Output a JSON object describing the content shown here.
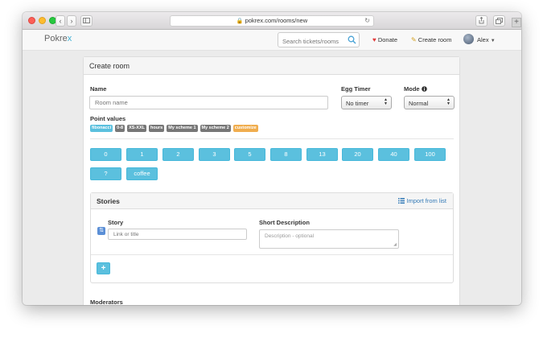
{
  "browser": {
    "url": "pokrex.com/rooms/new",
    "back": "‹",
    "forward": "›"
  },
  "navbar": {
    "brand_main": "Pokre",
    "brand_accent": "x",
    "search_placeholder": "Search tickets/rooms",
    "donate": "Donate",
    "create_room": "Create room",
    "user": "Alex"
  },
  "form": {
    "title": "Create room",
    "name_label": "Name",
    "name_placeholder": "Room name",
    "egg_timer_label": "Egg Timer",
    "egg_timer_value": "No timer",
    "mode_label": "Mode",
    "mode_value": "Normal",
    "point_values_label": "Point values",
    "schemes": [
      "fibonacci",
      "0-8",
      "XS-XXL",
      "hours",
      "My scheme 1",
      "My scheme 2",
      "customize"
    ],
    "cards": [
      "0",
      "1",
      "2",
      "3",
      "5",
      "8",
      "13",
      "20",
      "40",
      "100",
      "?",
      "coffee"
    ],
    "stories": {
      "title": "Stories",
      "import": "Import from list",
      "story_label": "Story",
      "story_placeholder": "Link or title",
      "desc_label": "Short Description",
      "desc_placeholder": "Description - optional"
    },
    "moderators_label": "Moderators"
  },
  "colors": {
    "accent": "#5bc0de",
    "badge_default": "#777777",
    "badge_customize": "#f0ad4e",
    "link": "#337ab7"
  },
  "icons": [
    "lock-icon",
    "reload-icon",
    "search-icon",
    "heart-icon",
    "pencil-icon",
    "info-icon",
    "list-icon",
    "sort-icon",
    "plus-icon"
  ]
}
